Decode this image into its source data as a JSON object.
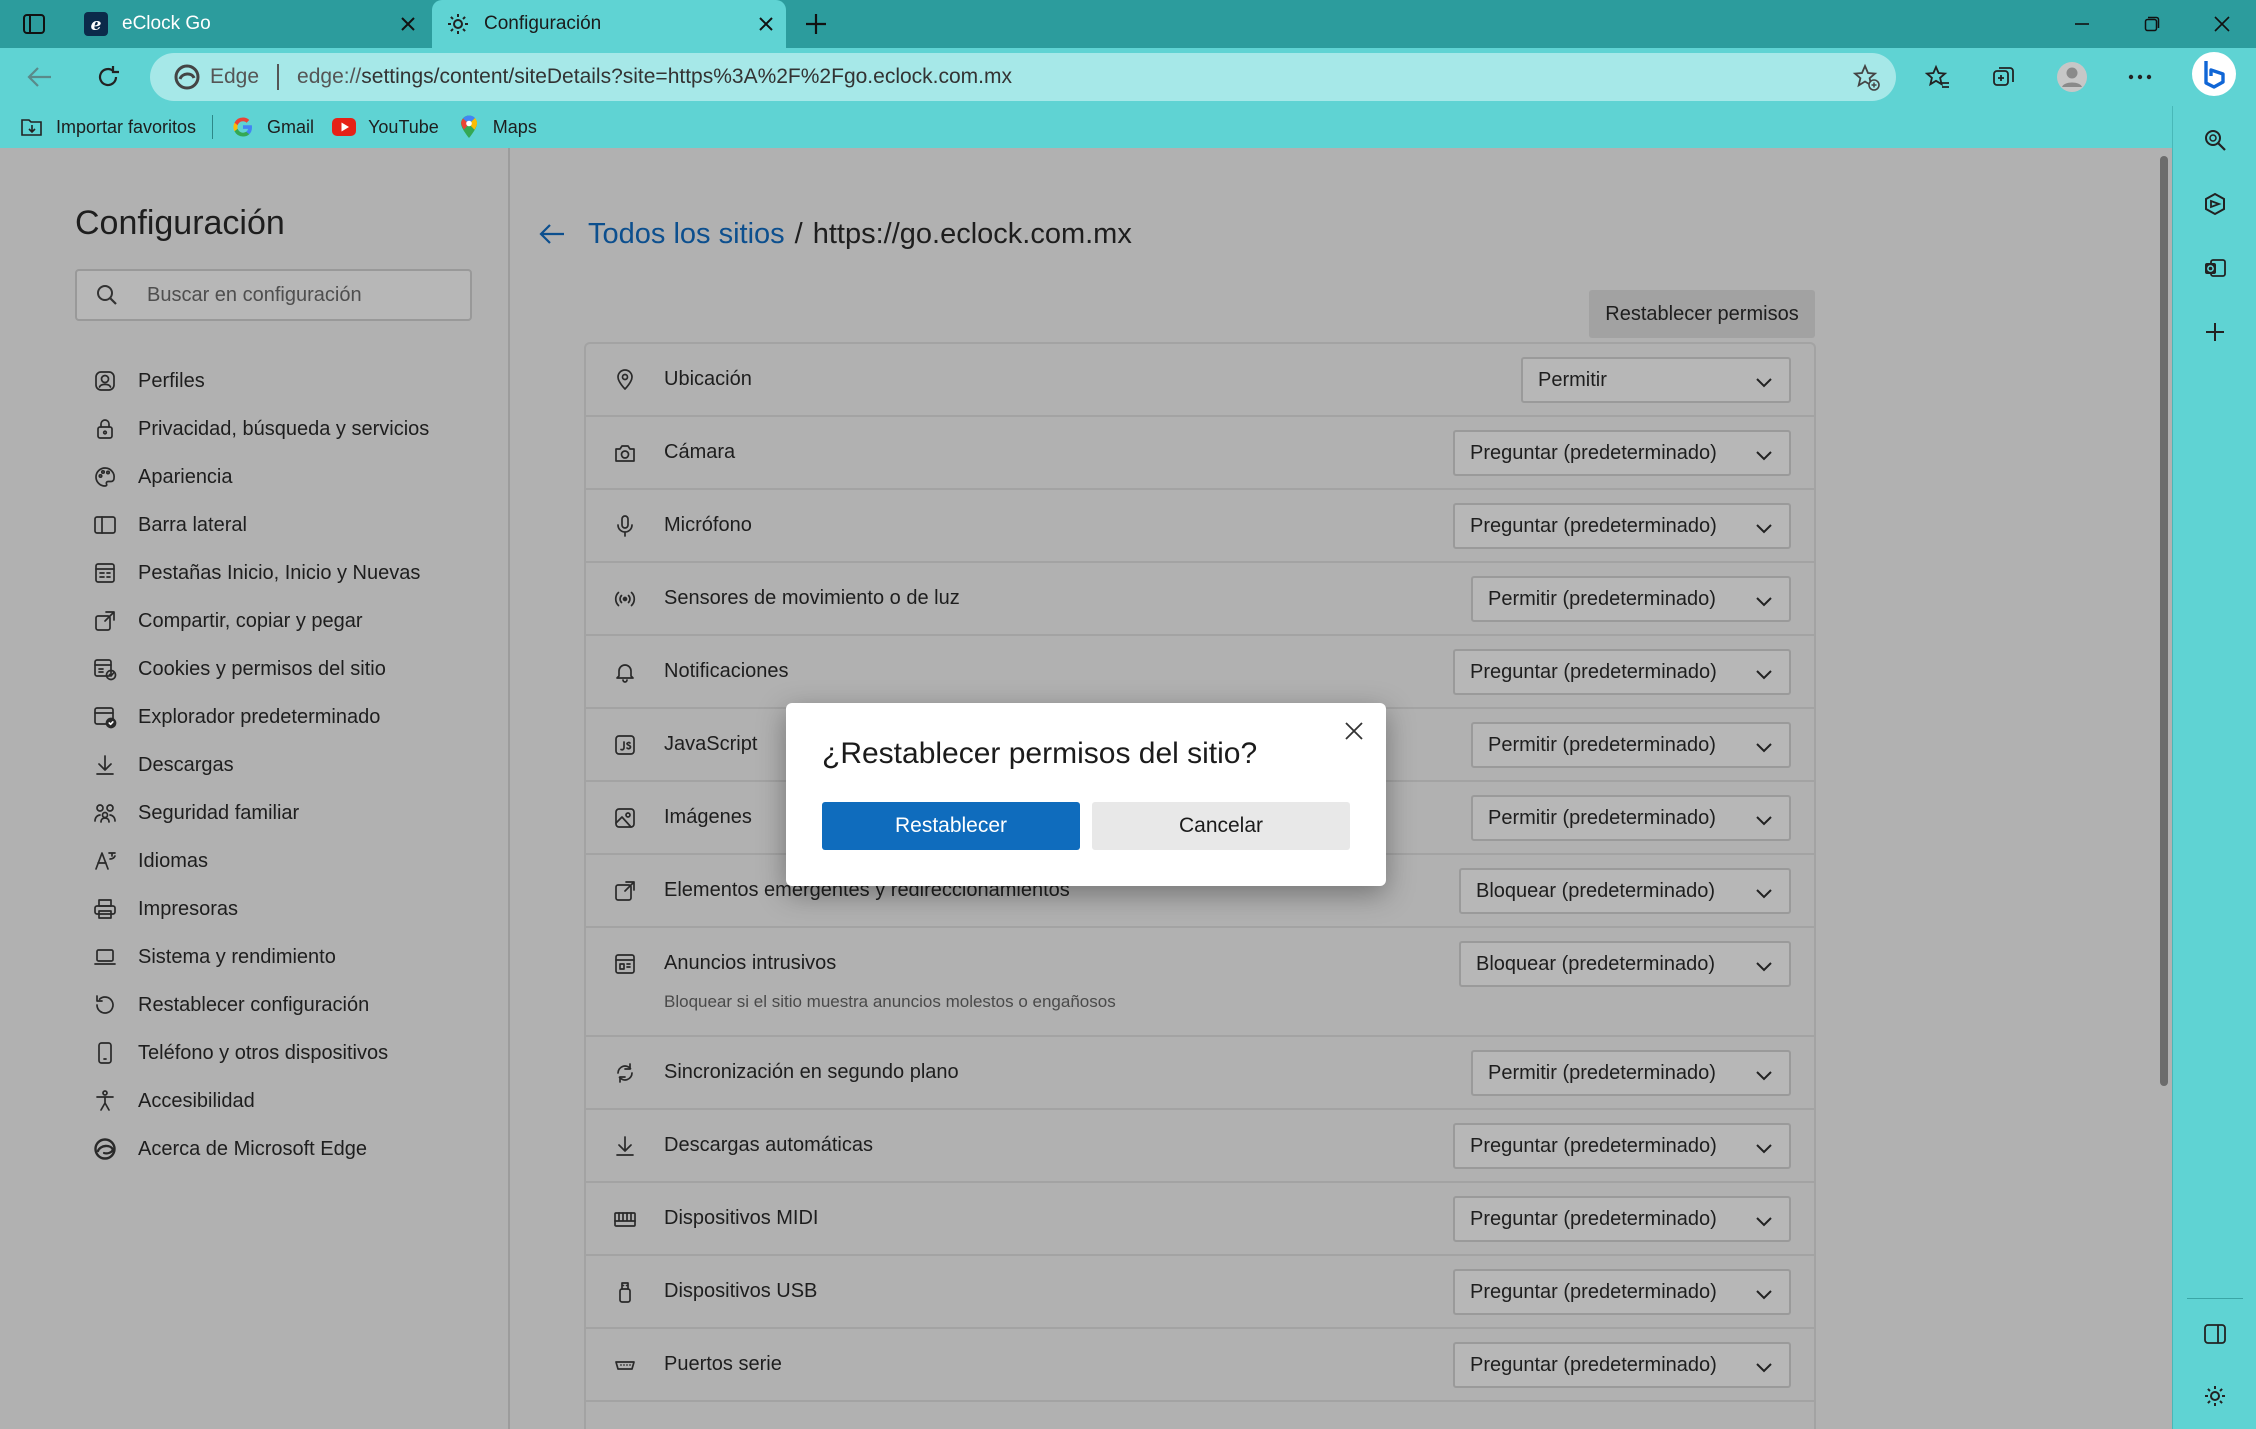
{
  "browser": {
    "tabs": [
      {
        "title": "eClock Go",
        "icon": "eclock-logo-icon",
        "active": false
      },
      {
        "title": "Configuración",
        "icon": "gear-icon",
        "active": true
      }
    ],
    "address": {
      "edge_label": "Edge",
      "url_host": "edge://",
      "url_path": "settings/content/siteDetails?site=https%3A%2F%2Fgo.eclock.com.mx"
    },
    "bookmarks": [
      {
        "label": "Importar favoritos",
        "icon": "import-favorites-icon"
      },
      {
        "label": "Gmail",
        "icon": "google-icon"
      },
      {
        "label": "YouTube",
        "icon": "youtube-icon"
      },
      {
        "label": "Maps",
        "icon": "maps-pin-icon"
      }
    ],
    "colors": {
      "frame": "#2c9c9d",
      "toolbar": "#5fd3d3",
      "primary_button": "#0f6cbd",
      "link": "#0c4f8e"
    }
  },
  "settings": {
    "title": "Configuración",
    "search_placeholder": "Buscar en configuración",
    "nav": [
      {
        "label": "Perfiles",
        "icon": "profile-icon"
      },
      {
        "label": "Privacidad, búsqueda y servicios",
        "icon": "lock-icon"
      },
      {
        "label": "Apariencia",
        "icon": "palette-icon"
      },
      {
        "label": "Barra lateral",
        "icon": "sidebar-icon"
      },
      {
        "label": "Pestañas Inicio, Inicio y Nuevas",
        "icon": "home-tabs-icon"
      },
      {
        "label": "Compartir, copiar y pegar",
        "icon": "share-icon"
      },
      {
        "label": "Cookies y permisos del sitio",
        "icon": "cookies-icon"
      },
      {
        "label": "Explorador predeterminado",
        "icon": "default-browser-icon"
      },
      {
        "label": "Descargas",
        "icon": "download-icon"
      },
      {
        "label": "Seguridad familiar",
        "icon": "family-icon"
      },
      {
        "label": "Idiomas",
        "icon": "language-icon"
      },
      {
        "label": "Impresoras",
        "icon": "printer-icon"
      },
      {
        "label": "Sistema y rendimiento",
        "icon": "laptop-icon"
      },
      {
        "label": "Restablecer configuración",
        "icon": "reset-icon"
      },
      {
        "label": "Teléfono y otros dispositivos",
        "icon": "phone-icon"
      },
      {
        "label": "Accesibilidad",
        "icon": "accessibility-icon"
      },
      {
        "label": "Acerca de Microsoft Edge",
        "icon": "edge-icon"
      }
    ]
  },
  "site": {
    "breadcrumb_link": "Todos los sitios",
    "breadcrumb_sep": "/",
    "site_url": "https://go.eclock.com.mx",
    "reset_button": "Restablecer permisos",
    "permissions": [
      {
        "label": "Ubicación",
        "value": "Permitir",
        "icon": "location-icon"
      },
      {
        "label": "Cámara",
        "value": "Preguntar (predeterminado)",
        "icon": "camera-icon"
      },
      {
        "label": "Micrófono",
        "value": "Preguntar (predeterminado)",
        "icon": "microphone-icon"
      },
      {
        "label": "Sensores de movimiento o de luz",
        "value": "Permitir (predeterminado)",
        "icon": "sensors-icon"
      },
      {
        "label": "Notificaciones",
        "value": "Preguntar (predeterminado)",
        "icon": "bell-icon"
      },
      {
        "label": "JavaScript",
        "value": "Permitir (predeterminado)",
        "icon": "javascript-icon"
      },
      {
        "label": "Imágenes",
        "value": "Permitir (predeterminado)",
        "icon": "image-icon"
      },
      {
        "label": "Elementos emergentes y redireccionamientos",
        "value": "Bloquear (predeterminado)",
        "icon": "popup-icon"
      },
      {
        "label": "Anuncios intrusivos",
        "value": "Bloquear (predeterminado)",
        "icon": "ads-icon",
        "description": "Bloquear si el sitio muestra anuncios molestos o engañosos"
      },
      {
        "label": "Sincronización en segundo plano",
        "value": "Permitir (predeterminado)",
        "icon": "sync-icon"
      },
      {
        "label": "Descargas automáticas",
        "value": "Preguntar (predeterminado)",
        "icon": "download-icon"
      },
      {
        "label": "Dispositivos MIDI",
        "value": "Preguntar (predeterminado)",
        "icon": "midi-icon"
      },
      {
        "label": "Dispositivos USB",
        "value": "Preguntar (predeterminado)",
        "icon": "usb-icon"
      },
      {
        "label": "Puertos serie",
        "value": "Preguntar (predeterminado)",
        "icon": "serial-port-icon"
      }
    ]
  },
  "dialog": {
    "title": "¿Restablecer permisos del sitio?",
    "confirm": "Restablecer",
    "cancel": "Cancelar"
  }
}
